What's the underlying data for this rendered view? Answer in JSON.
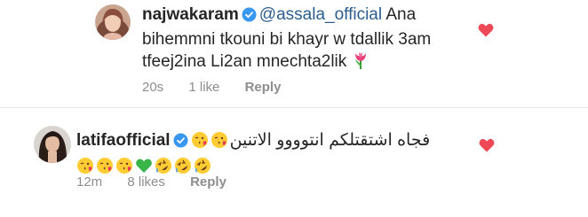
{
  "comments": [
    {
      "username": "najwakaram",
      "mention": "@assala_official",
      "text": "Ana bihemmni tkouni bi khayr w tdallik 3am tfeej2ina Li2an mnechta2lik",
      "time": "20s",
      "likes": "1 like",
      "reply": "Reply",
      "emoji": [
        "tulip"
      ]
    },
    {
      "username": "latifaofficial",
      "text": "فجاه اشتقتلكم انتوووو الاتنين",
      "time": "12m",
      "likes": "8 likes",
      "reply": "Reply",
      "emoji_line1": [
        "face-blowing-kiss",
        "face-blowing-kiss"
      ],
      "emoji_line2": [
        "face-blowing-kiss",
        "face-blowing-kiss",
        "face-blowing-kiss",
        "green-heart",
        "rolling-laughing-face",
        "rolling-laughing-face",
        "rolling-laughing-face"
      ]
    }
  ],
  "colors": {
    "heart": "#ed4956",
    "verified": "#3897f0",
    "mention": "#2b5d8f",
    "meta": "#8e8e8e"
  }
}
